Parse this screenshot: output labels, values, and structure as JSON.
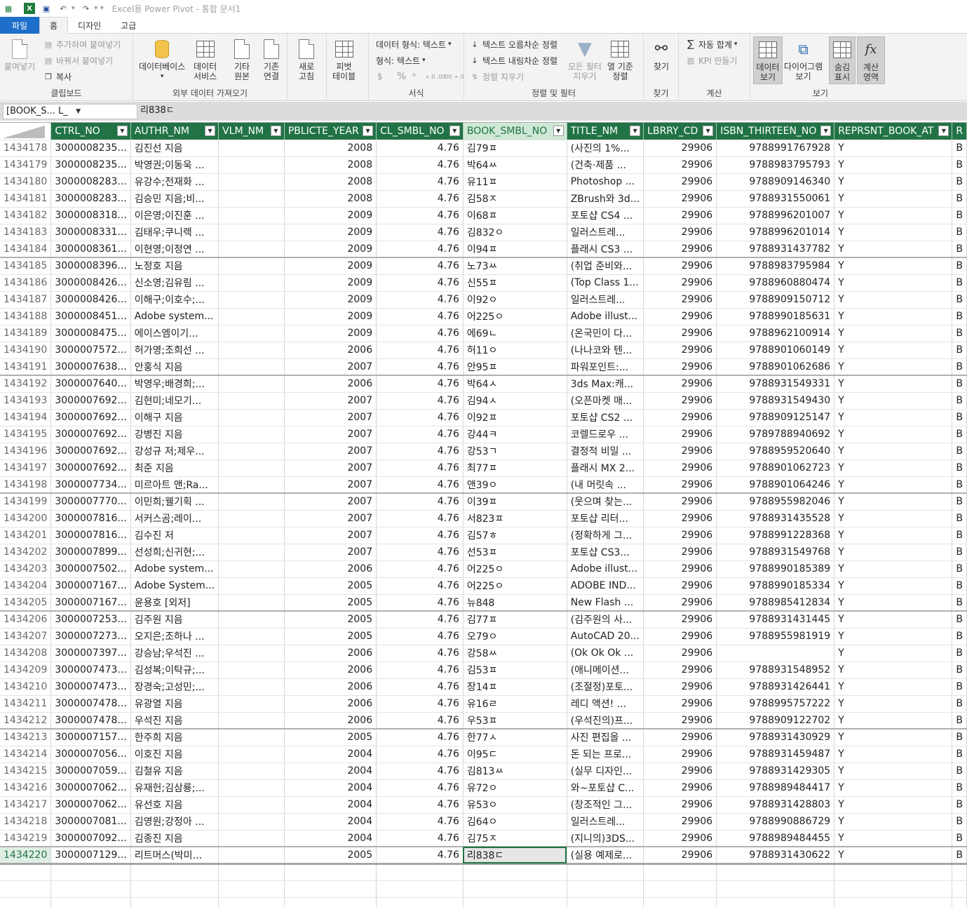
{
  "titlebar": {
    "title": "Excel용 Power Pivot - 통합 문서1"
  },
  "tabs": [
    {
      "label": "파일"
    },
    {
      "label": "홈"
    },
    {
      "label": "디자인"
    },
    {
      "label": "고급"
    }
  ],
  "ribbon": {
    "clipboard": {
      "paste": "붙여넣기",
      "paste_append": "추가하여 붙여넣기",
      "paste_replace": "바꿔서 붙여넣기",
      "copy": "복사",
      "label": "클립보드"
    },
    "external": {
      "database": "데이터베이스",
      "data_service_1": "데이터",
      "data_service_2": "서비스",
      "other_source_1": "기타",
      "other_source_2": "원본",
      "existing_conn_1": "기존",
      "existing_conn_2": "연결",
      "label": "외부 데이터 가져오기"
    },
    "refresh": {
      "line1": "새로",
      "line2": "고침"
    },
    "pivot": {
      "line1": "피벗",
      "line2": "테이블"
    },
    "format": {
      "data_type": "데이터 형식: 텍스트",
      "format": "형식: 텍스트",
      "currency": "$",
      "percent": "%",
      "comma": "⁹",
      "inc_dec": "+.0 .00",
      "dec_dec": ".00 +.0",
      "label": "서식"
    },
    "sort": {
      "asc": "텍스트 오름차순 정렬",
      "desc": "텍스트 내림차순 정렬",
      "clear": "정렬 지우기",
      "clear_filter_1": "모든 필터",
      "clear_filter_2": "지우기",
      "sort_by_col_1": "열 기준",
      "sort_by_col_2": "정렬",
      "label": "정렬 및 필터"
    },
    "find": {
      "btn": "찾기",
      "label": "찾기"
    },
    "calc": {
      "autosum": "자동 합계",
      "kpi": "KPI 만들기",
      "label": "계산"
    },
    "view": {
      "data_view_1": "데이터",
      "data_view_2": "보기",
      "diagram_1": "다이어그램",
      "diagram_2": "보기",
      "show_hidden_1": "숨김",
      "show_hidden_2": "표시",
      "calc_area_1": "계산",
      "calc_area_2": "영역",
      "label": "보기"
    }
  },
  "formula_bar": {
    "name_box": "[BOOK_S...  L_",
    "value": "리838ㄷ"
  },
  "columns": [
    "CTRL_NO",
    "AUTHR_NM",
    "VLM_NM",
    "PBLICTE_YEAR",
    "CL_SMBL_NO",
    "BOOK_SMBL_NO",
    "TITLE_NM",
    "LBRRY_CD",
    "ISBN_THIRTEEN_NO",
    "REPRSNT_BOOK_AT",
    "R"
  ],
  "rows": [
    [
      "1434178",
      "3000008235...",
      "김진선 지음",
      "",
      "2008",
      "4.76",
      "김79ㅍ",
      "(사진의 1%...",
      "29906",
      "9788991767928",
      "Y",
      "B"
    ],
    [
      "1434179",
      "3000008235...",
      "박영권;이동욱 ...",
      "",
      "2008",
      "4.76",
      "박64ㅆ",
      "(건축·제품 ...",
      "29906",
      "9788983795793",
      "Y",
      "B"
    ],
    [
      "1434180",
      "3000008283...",
      "유강수;전재화 ...",
      "",
      "2008",
      "4.76",
      "유11ㅍ",
      "Photoshop ...",
      "29906",
      "9788909146340",
      "Y",
      "B"
    ],
    [
      "1434181",
      "3000008283...",
      "김승민 지음;비...",
      "",
      "2008",
      "4.76",
      "김58ㅈ",
      "ZBrush와 3d...",
      "29906",
      "9788931550061",
      "Y",
      "B"
    ],
    [
      "1434182",
      "3000008318...",
      "이은영;이진훈 ...",
      "",
      "2009",
      "4.76",
      "이68ㅍ",
      "포토샵 CS4 ...",
      "29906",
      "9788996201007",
      "Y",
      "B"
    ],
    [
      "1434183",
      "3000008331...",
      "김태우;쿠니렉 ...",
      "",
      "2009",
      "4.76",
      "김832ㅇ",
      "일러스트레...",
      "29906",
      "9788996201014",
      "Y",
      "B"
    ],
    [
      "1434184",
      "3000008361...",
      "이현영;이정연 ...",
      "",
      "2009",
      "4.76",
      "이94ㅍ",
      "플래시 CS3 ...",
      "29906",
      "9788931437782",
      "Y",
      "B"
    ],
    [
      "1434185",
      "3000008396...",
      "노정호 지음",
      "",
      "2009",
      "4.76",
      "노73ㅆ",
      "(취업 준비와...",
      "29906",
      "9788983795984",
      "Y",
      "B"
    ],
    [
      "1434186",
      "3000008426...",
      "신소영;김유림 ...",
      "",
      "2009",
      "4.76",
      "신55ㅍ",
      "(Top Class 1...",
      "29906",
      "9788960880474",
      "Y",
      "B"
    ],
    [
      "1434187",
      "3000008426...",
      "이해구;이호수;...",
      "",
      "2009",
      "4.76",
      "이92ㅇ",
      "일러스트레...",
      "29906",
      "9788909150712",
      "Y",
      "B"
    ],
    [
      "1434188",
      "3000008451...",
      "Adobe system...",
      "",
      "2009",
      "4.76",
      "어225ㅇ",
      "Adobe illust...",
      "29906",
      "9788990185631",
      "Y",
      "B"
    ],
    [
      "1434189",
      "3000008475...",
      "에이스엠이기...",
      "",
      "2009",
      "4.76",
      "에69ㄴ",
      "(온국민이 다...",
      "29906",
      "9788962100914",
      "Y",
      "B"
    ],
    [
      "1434190",
      "3000007572...",
      "허가영;조희선 ...",
      "",
      "2006",
      "4.76",
      "허11ㅇ",
      "(나나코와 텐...",
      "29906",
      "9788901060149",
      "Y",
      "B"
    ],
    [
      "1434191",
      "3000007638...",
      "안홍식 지음",
      "",
      "2007",
      "4.76",
      "안95ㅍ",
      "파워포인트:...",
      "29906",
      "9788901062686",
      "Y",
      "B"
    ],
    [
      "1434192",
      "3000007640...",
      "박영우;배경희;...",
      "",
      "2006",
      "4.76",
      "박64ㅅ",
      "3ds Max:캐...",
      "29906",
      "9788931549331",
      "Y",
      "B"
    ],
    [
      "1434193",
      "3000007692...",
      "김현미;네모기...",
      "",
      "2007",
      "4.76",
      "김94ㅅ",
      "(오픈마켓 매...",
      "29906",
      "9788931549430",
      "Y",
      "B"
    ],
    [
      "1434194",
      "3000007692...",
      "이해구 지음",
      "",
      "2007",
      "4.76",
      "이92ㅍ",
      "포토샵 CS2 ...",
      "29906",
      "9788909125147",
      "Y",
      "B"
    ],
    [
      "1434195",
      "3000007692...",
      "강병진 지음",
      "",
      "2007",
      "4.76",
      "강44ㅋ",
      "코렐드로우 ...",
      "29906",
      "9789788940692",
      "Y",
      "B"
    ],
    [
      "1434196",
      "3000007692...",
      "강성규 저;제우...",
      "",
      "2007",
      "4.76",
      "강53ㄱ",
      "결정적 비밀 ...",
      "29906",
      "9788959520640",
      "Y",
      "B"
    ],
    [
      "1434197",
      "3000007692...",
      "최준 지음",
      "",
      "2007",
      "4.76",
      "최77ㅍ",
      "플래시 MX 2...",
      "29906",
      "9788901062723",
      "Y",
      "B"
    ],
    [
      "1434198",
      "3000007734...",
      "미르아트 앤;Ra...",
      "",
      "2007",
      "4.76",
      "앤39ㅇ",
      "(내 머릿속 ...",
      "29906",
      "9788901064246",
      "Y",
      "B"
    ],
    [
      "1434199",
      "3000007770...",
      "이민희;웰기획 ...",
      "",
      "2007",
      "4.76",
      "이39ㅍ",
      "(웃으며 찾는...",
      "29906",
      "9788955982046",
      "Y",
      "B"
    ],
    [
      "1434200",
      "3000007816...",
      "서커스곰;레이...",
      "",
      "2007",
      "4.76",
      "서823ㅍ",
      "포토샵 리터...",
      "29906",
      "9788931435528",
      "Y",
      "B"
    ],
    [
      "1434201",
      "3000007816...",
      "김수진 저",
      "",
      "2007",
      "4.76",
      "김57ㅎ",
      "(정확하게 그...",
      "29906",
      "9788991228368",
      "Y",
      "B"
    ],
    [
      "1434202",
      "3000007899...",
      "선성희;신귀현;...",
      "",
      "2007",
      "4.76",
      "선53ㅍ",
      "포토샵 CS3...",
      "29906",
      "9788931549768",
      "Y",
      "B"
    ],
    [
      "1434203",
      "3000007502...",
      "Adobe system...",
      "",
      "2006",
      "4.76",
      "어225ㅇ",
      "Adobe illust...",
      "29906",
      "9788990185389",
      "Y",
      "B"
    ],
    [
      "1434204",
      "3000007167...",
      "Adobe System...",
      "",
      "2005",
      "4.76",
      "어225ㅇ",
      "ADOBE IND...",
      "29906",
      "9788990185334",
      "Y",
      "B"
    ],
    [
      "1434205",
      "3000007167...",
      "윤용호 [외저]",
      "",
      "2005",
      "4.76",
      "뉴848",
      "New Flash ...",
      "29906",
      "9788985412834",
      "Y",
      "B"
    ],
    [
      "1434206",
      "3000007253...",
      "김주원 지음",
      "",
      "2005",
      "4.76",
      "김77ㅍ",
      "(김주원의 사...",
      "29906",
      "9788931431445",
      "Y",
      "B"
    ],
    [
      "1434207",
      "3000007273...",
      "오지은;조하나 ...",
      "",
      "2005",
      "4.76",
      "오79ㅇ",
      "AutoCAD 20...",
      "29906",
      "9788955981919",
      "Y",
      "B"
    ],
    [
      "1434208",
      "3000007397...",
      "강승남;우석진 ...",
      "",
      "2006",
      "4.76",
      "강58ㅆ",
      "(Ok Ok Ok ...",
      "29906",
      "",
      "Y",
      "B"
    ],
    [
      "1434209",
      "3000007473...",
      "김성복;이탁규;...",
      "",
      "2006",
      "4.76",
      "김53ㅍ",
      "(애니메이션...",
      "29906",
      "9788931548952",
      "Y",
      "B"
    ],
    [
      "1434210",
      "3000007473...",
      "장경숙;고성민;...",
      "",
      "2006",
      "4.76",
      "장14ㅍ",
      "(조절정)포토...",
      "29906",
      "9788931426441",
      "Y",
      "B"
    ],
    [
      "1434211",
      "3000007478...",
      "유광열 지음",
      "",
      "2006",
      "4.76",
      "유16ㄹ",
      "레디 액션! ...",
      "29906",
      "9788995757222",
      "Y",
      "B"
    ],
    [
      "1434212",
      "3000007478...",
      "우석진 지음",
      "",
      "2006",
      "4.76",
      "우53ㅍ",
      "(우석진의)프...",
      "29906",
      "9788909122702",
      "Y",
      "B"
    ],
    [
      "1434213",
      "3000007157...",
      "한주희 지음",
      "",
      "2005",
      "4.76",
      "한77ㅅ",
      "사진 편집을 ...",
      "29906",
      "9788931430929",
      "Y",
      "B"
    ],
    [
      "1434214",
      "3000007056...",
      "이호진 지음",
      "",
      "2004",
      "4.76",
      "이95ㄷ",
      "돈 되는 프로...",
      "29906",
      "9788931459487",
      "Y",
      "B"
    ],
    [
      "1434215",
      "3000007059...",
      "김철유 지음",
      "",
      "2004",
      "4.76",
      "김813ㅆ",
      "(실무 디자인...",
      "29906",
      "9788931429305",
      "Y",
      "B"
    ],
    [
      "1434216",
      "3000007062...",
      "유재헌;김삼룡;...",
      "",
      "2004",
      "4.76",
      "유72ㅇ",
      "와~포토샵 C...",
      "29906",
      "9788989484417",
      "Y",
      "B"
    ],
    [
      "1434217",
      "3000007062...",
      "유선호 지음",
      "",
      "2004",
      "4.76",
      "유53ㅇ",
      "(창조적인 그...",
      "29906",
      "9788931428803",
      "Y",
      "B"
    ],
    [
      "1434218",
      "3000007081...",
      "김영원;강정아 ...",
      "",
      "2004",
      "4.76",
      "김64ㅇ",
      "일러스트레...",
      "29906",
      "9788990886729",
      "Y",
      "B"
    ],
    [
      "1434219",
      "3000007092...",
      "김종진 지음",
      "",
      "2004",
      "4.76",
      "김75ㅈ",
      "(지니의)3DS...",
      "29906",
      "9788989484455",
      "Y",
      "B"
    ],
    [
      "1434220",
      "3000007129...",
      "리트머스(박미...",
      "",
      "2005",
      "4.76",
      "리838ㄷ",
      "(실용 예제로...",
      "29906",
      "9788931430622",
      "Y",
      "B"
    ]
  ],
  "icons": {
    "powerpivot": "table-grid-icon",
    "excel": "excel-icon",
    "save": "save-icon",
    "undo": "undo-icon",
    "redo": "redo-icon",
    "filter_button": "chevron-down-icon"
  },
  "colors": {
    "header_green": "#217346",
    "file_tab_blue": "#1e6fc9",
    "ribbon_bg": "#f3f3f3"
  }
}
